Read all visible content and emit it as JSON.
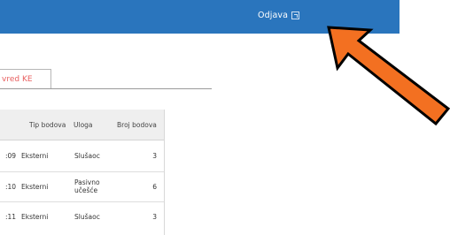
{
  "header": {
    "logout_label": "Odjava"
  },
  "tabs": [
    {
      "label": "vred KE"
    }
  ],
  "table": {
    "columns": [
      "Tip bodova",
      "Uloga",
      "Broj bodova"
    ],
    "rows": [
      {
        "time": ":09",
        "type": "Eksterni",
        "role": "Slušaoc",
        "points": "3"
      },
      {
        "time": ":10",
        "type": "Eksterni",
        "role": "Pasivno učešće",
        "points": "6"
      },
      {
        "time": ":11",
        "type": "Eksterni",
        "role": "Slušaoc",
        "points": "3"
      }
    ]
  },
  "colors": {
    "topbar": "#2a75bd",
    "tab_text": "#e86060",
    "arrow_fill": "#f37021",
    "arrow_stroke": "#000000"
  },
  "icons": {
    "logout": "logout-icon",
    "annotation": "arrow-pointer-icon"
  }
}
